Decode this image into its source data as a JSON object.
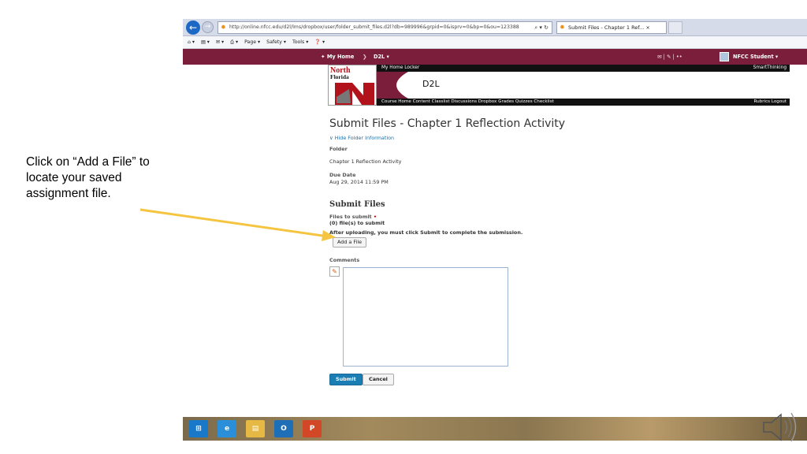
{
  "instruction": {
    "text": "Click on “Add a File” to locate your saved assignment file."
  },
  "browser": {
    "address_url": "http://online.nfcc.edu/d2l/lms/dropbox/user/folder_submit_files.d2l?db=989996&grpid=0&isprv=0&bp=0&ou=123388",
    "address_controls": "⌕ ▾ ↻",
    "tab_title": "Submit Files - Chapter 1 Ref... ×",
    "toolbar_items": [
      "⌂ ▾",
      "▤ ▾",
      "✉ ▾",
      "⎙ ▾",
      "Page ▾",
      "Safety ▾",
      "Tools ▾",
      "❓ ▾"
    ],
    "icons": {
      "back": "arrow-left-icon",
      "forward": "arrow-right-icon"
    }
  },
  "minibar": {
    "home_label": "✦ My Home",
    "separator": "❯",
    "course_label": "D2L ▾",
    "icons_text": "✉  |  ✎  |  ••",
    "user_label": "NFCC Student ▾"
  },
  "header": {
    "logo_north": "North",
    "logo_florida": "Florida",
    "top_link": "My Home Locker",
    "smart": "SmartThinking",
    "site_title": "D2L",
    "nav_links": "Course Home  Content  Classlist  Discussions  Dropbox  Grades  Quizzes  Checklist",
    "right_links": "Rubrics  Logout"
  },
  "page": {
    "title": "Submit Files - Chapter 1 Reflection Activity",
    "hide_folder": "∨  Hide Folder Information",
    "folder_label": "Folder",
    "folder_value": "Chapter 1 Reflection Activity",
    "due_label": "Due Date",
    "due_value": "Aug 29, 2014 11:59 PM",
    "section_title": "Submit Files",
    "files_to_submit_label": "Files to submit",
    "required_mark": " •",
    "files_count": "(0) file(s) to submit",
    "after_upload_note": "After uploading, you must click Submit to complete the submission.",
    "add_file_button": "Add a File",
    "comments_label": "Comments",
    "submit_button": "Submit",
    "cancel_button": "Cancel"
  },
  "taskbar": {
    "start": "⊞",
    "ie": "e",
    "files": "▤",
    "outlook": "O",
    "ppt": "P"
  },
  "colors": {
    "minibar": "#7a1e3c",
    "link": "#1d6fa5",
    "primary_button": "#1a7db3",
    "arrow": "#f5c542"
  }
}
